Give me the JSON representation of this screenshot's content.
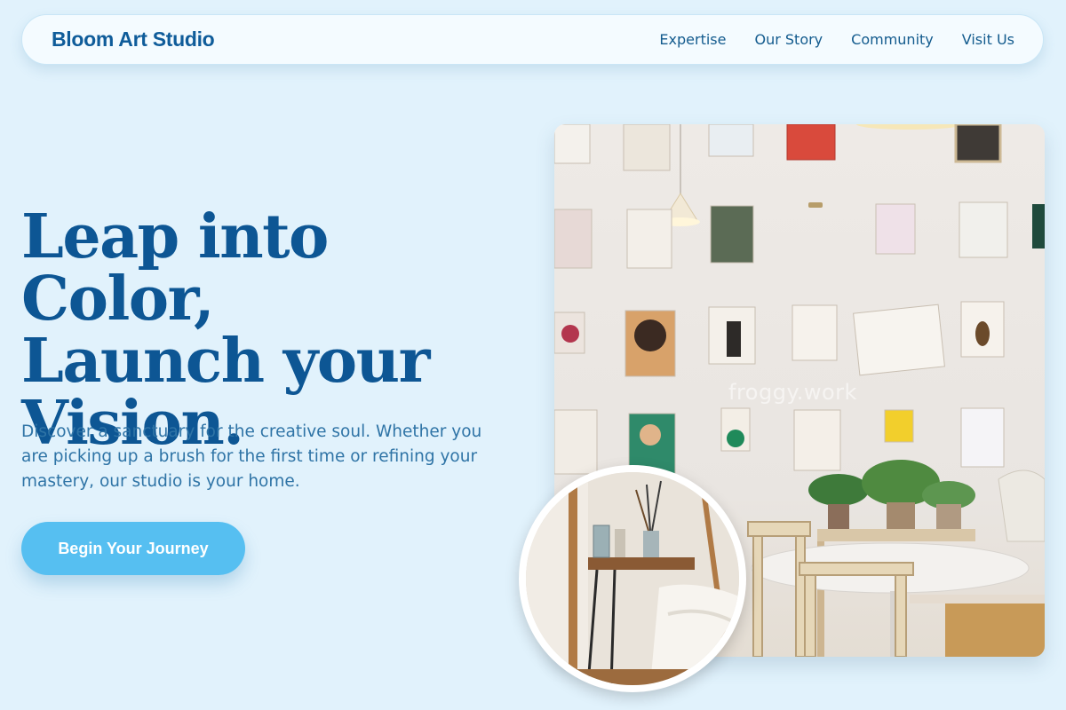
{
  "header": {
    "brand": "Bloom Art Studio",
    "nav": [
      {
        "label": "Expertise"
      },
      {
        "label": "Our Story"
      },
      {
        "label": "Community"
      },
      {
        "label": "Visit Us"
      }
    ]
  },
  "hero": {
    "headline_lines": [
      "Leap into Color,",
      "Launch your",
      "Vision."
    ],
    "lede": "Discover a sanctuary for the creative soul. Whether you are picking up a brush for the first time or refining your mastery, our studio is your home.",
    "cta_label": "Begin Your Journey"
  },
  "media": {
    "watermark": "froggy.work"
  },
  "colors": {
    "background": "#e1f2fc",
    "brand": "#0f5c9a",
    "headline": "#0d5694",
    "body_text": "#2f74a6",
    "cta": "#56bff1"
  }
}
